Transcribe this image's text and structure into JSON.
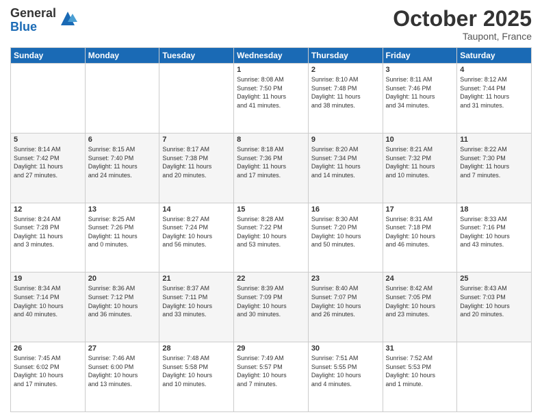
{
  "header": {
    "logo_general": "General",
    "logo_blue": "Blue",
    "month_title": "October 2025",
    "location": "Taupont, France"
  },
  "days_of_week": [
    "Sunday",
    "Monday",
    "Tuesday",
    "Wednesday",
    "Thursday",
    "Friday",
    "Saturday"
  ],
  "weeks": [
    [
      {
        "day": "",
        "info": ""
      },
      {
        "day": "",
        "info": ""
      },
      {
        "day": "",
        "info": ""
      },
      {
        "day": "1",
        "info": "Sunrise: 8:08 AM\nSunset: 7:50 PM\nDaylight: 11 hours\nand 41 minutes."
      },
      {
        "day": "2",
        "info": "Sunrise: 8:10 AM\nSunset: 7:48 PM\nDaylight: 11 hours\nand 38 minutes."
      },
      {
        "day": "3",
        "info": "Sunrise: 8:11 AM\nSunset: 7:46 PM\nDaylight: 11 hours\nand 34 minutes."
      },
      {
        "day": "4",
        "info": "Sunrise: 8:12 AM\nSunset: 7:44 PM\nDaylight: 11 hours\nand 31 minutes."
      }
    ],
    [
      {
        "day": "5",
        "info": "Sunrise: 8:14 AM\nSunset: 7:42 PM\nDaylight: 11 hours\nand 27 minutes."
      },
      {
        "day": "6",
        "info": "Sunrise: 8:15 AM\nSunset: 7:40 PM\nDaylight: 11 hours\nand 24 minutes."
      },
      {
        "day": "7",
        "info": "Sunrise: 8:17 AM\nSunset: 7:38 PM\nDaylight: 11 hours\nand 20 minutes."
      },
      {
        "day": "8",
        "info": "Sunrise: 8:18 AM\nSunset: 7:36 PM\nDaylight: 11 hours\nand 17 minutes."
      },
      {
        "day": "9",
        "info": "Sunrise: 8:20 AM\nSunset: 7:34 PM\nDaylight: 11 hours\nand 14 minutes."
      },
      {
        "day": "10",
        "info": "Sunrise: 8:21 AM\nSunset: 7:32 PM\nDaylight: 11 hours\nand 10 minutes."
      },
      {
        "day": "11",
        "info": "Sunrise: 8:22 AM\nSunset: 7:30 PM\nDaylight: 11 hours\nand 7 minutes."
      }
    ],
    [
      {
        "day": "12",
        "info": "Sunrise: 8:24 AM\nSunset: 7:28 PM\nDaylight: 11 hours\nand 3 minutes."
      },
      {
        "day": "13",
        "info": "Sunrise: 8:25 AM\nSunset: 7:26 PM\nDaylight: 11 hours\nand 0 minutes."
      },
      {
        "day": "14",
        "info": "Sunrise: 8:27 AM\nSunset: 7:24 PM\nDaylight: 10 hours\nand 56 minutes."
      },
      {
        "day": "15",
        "info": "Sunrise: 8:28 AM\nSunset: 7:22 PM\nDaylight: 10 hours\nand 53 minutes."
      },
      {
        "day": "16",
        "info": "Sunrise: 8:30 AM\nSunset: 7:20 PM\nDaylight: 10 hours\nand 50 minutes."
      },
      {
        "day": "17",
        "info": "Sunrise: 8:31 AM\nSunset: 7:18 PM\nDaylight: 10 hours\nand 46 minutes."
      },
      {
        "day": "18",
        "info": "Sunrise: 8:33 AM\nSunset: 7:16 PM\nDaylight: 10 hours\nand 43 minutes."
      }
    ],
    [
      {
        "day": "19",
        "info": "Sunrise: 8:34 AM\nSunset: 7:14 PM\nDaylight: 10 hours\nand 40 minutes."
      },
      {
        "day": "20",
        "info": "Sunrise: 8:36 AM\nSunset: 7:12 PM\nDaylight: 10 hours\nand 36 minutes."
      },
      {
        "day": "21",
        "info": "Sunrise: 8:37 AM\nSunset: 7:11 PM\nDaylight: 10 hours\nand 33 minutes."
      },
      {
        "day": "22",
        "info": "Sunrise: 8:39 AM\nSunset: 7:09 PM\nDaylight: 10 hours\nand 30 minutes."
      },
      {
        "day": "23",
        "info": "Sunrise: 8:40 AM\nSunset: 7:07 PM\nDaylight: 10 hours\nand 26 minutes."
      },
      {
        "day": "24",
        "info": "Sunrise: 8:42 AM\nSunset: 7:05 PM\nDaylight: 10 hours\nand 23 minutes."
      },
      {
        "day": "25",
        "info": "Sunrise: 8:43 AM\nSunset: 7:03 PM\nDaylight: 10 hours\nand 20 minutes."
      }
    ],
    [
      {
        "day": "26",
        "info": "Sunrise: 7:45 AM\nSunset: 6:02 PM\nDaylight: 10 hours\nand 17 minutes."
      },
      {
        "day": "27",
        "info": "Sunrise: 7:46 AM\nSunset: 6:00 PM\nDaylight: 10 hours\nand 13 minutes."
      },
      {
        "day": "28",
        "info": "Sunrise: 7:48 AM\nSunset: 5:58 PM\nDaylight: 10 hours\nand 10 minutes."
      },
      {
        "day": "29",
        "info": "Sunrise: 7:49 AM\nSunset: 5:57 PM\nDaylight: 10 hours\nand 7 minutes."
      },
      {
        "day": "30",
        "info": "Sunrise: 7:51 AM\nSunset: 5:55 PM\nDaylight: 10 hours\nand 4 minutes."
      },
      {
        "day": "31",
        "info": "Sunrise: 7:52 AM\nSunset: 5:53 PM\nDaylight: 10 hours\nand 1 minute."
      },
      {
        "day": "",
        "info": ""
      }
    ]
  ]
}
